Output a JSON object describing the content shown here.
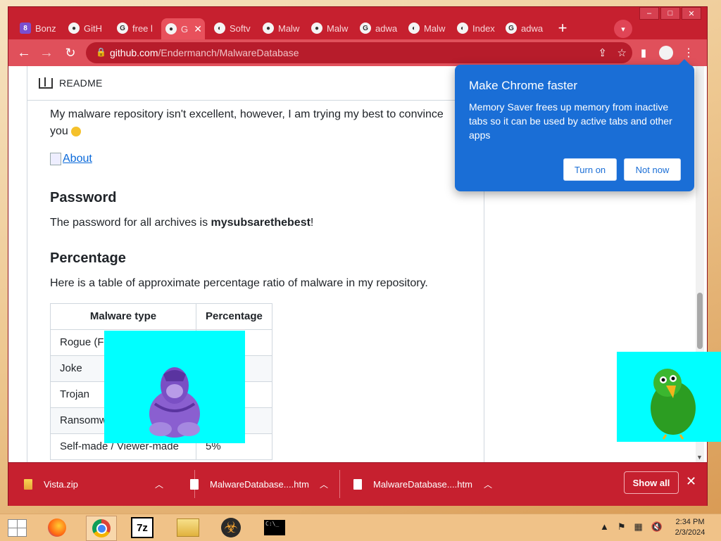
{
  "browser": {
    "tabs": [
      {
        "title": "Bonz",
        "icon": "bonzi-favicon"
      },
      {
        "title": "GitH",
        "icon": "github-icon"
      },
      {
        "title": "free l",
        "icon": "google-icon"
      },
      {
        "title": "G",
        "icon": "github-icon",
        "active": true
      },
      {
        "title": "Softv",
        "icon": "globe-icon"
      },
      {
        "title": "Malw",
        "icon": "github-icon"
      },
      {
        "title": "Malw",
        "icon": "github-icon"
      },
      {
        "title": "adwa",
        "icon": "google-icon"
      },
      {
        "title": "Malw",
        "icon": "globe-icon"
      },
      {
        "title": "Index",
        "icon": "globe-icon"
      },
      {
        "title": "adwa",
        "icon": "google-icon"
      }
    ],
    "url_host": "github.com",
    "url_path": "/Endermanch/MalwareDatabase",
    "accent": "#c6202f"
  },
  "readme": {
    "header_label": "README",
    "intro": "My malware repository isn't excellent, however, I am trying my best to convince you",
    "about_link": "About",
    "password_heading": "Password",
    "password_prefix": "The password for all archives is ",
    "password_value": "mysubsarethebest",
    "password_suffix": "!",
    "percentage_heading": "Percentage",
    "percentage_text": "Here is a table of approximate percentage ratio of malware in my repository.",
    "table": {
      "headers": [
        "Malware type",
        "Percentage"
      ],
      "rows": [
        [
          "Rogue (F",
          ""
        ],
        [
          "Joke",
          ""
        ],
        [
          "Trojan",
          ""
        ],
        [
          "Ransomw",
          ""
        ],
        [
          "Self-made / Viewer-made",
          "5%"
        ]
      ]
    }
  },
  "promo": {
    "title": "Make Chrome faster",
    "body": "Memory Saver frees up memory from inactive tabs so it can be used by active tabs and other apps",
    "turn_on": "Turn on",
    "not_now": "Not now",
    "color": "#1a6ed6"
  },
  "downloads": {
    "items": [
      "Vista.zip",
      "MalwareDatabase....htm",
      "MalwareDatabase....htm"
    ],
    "show_all": "Show all"
  },
  "taskbar": {
    "time": "2:34 PM",
    "date": "2/3/2024"
  }
}
